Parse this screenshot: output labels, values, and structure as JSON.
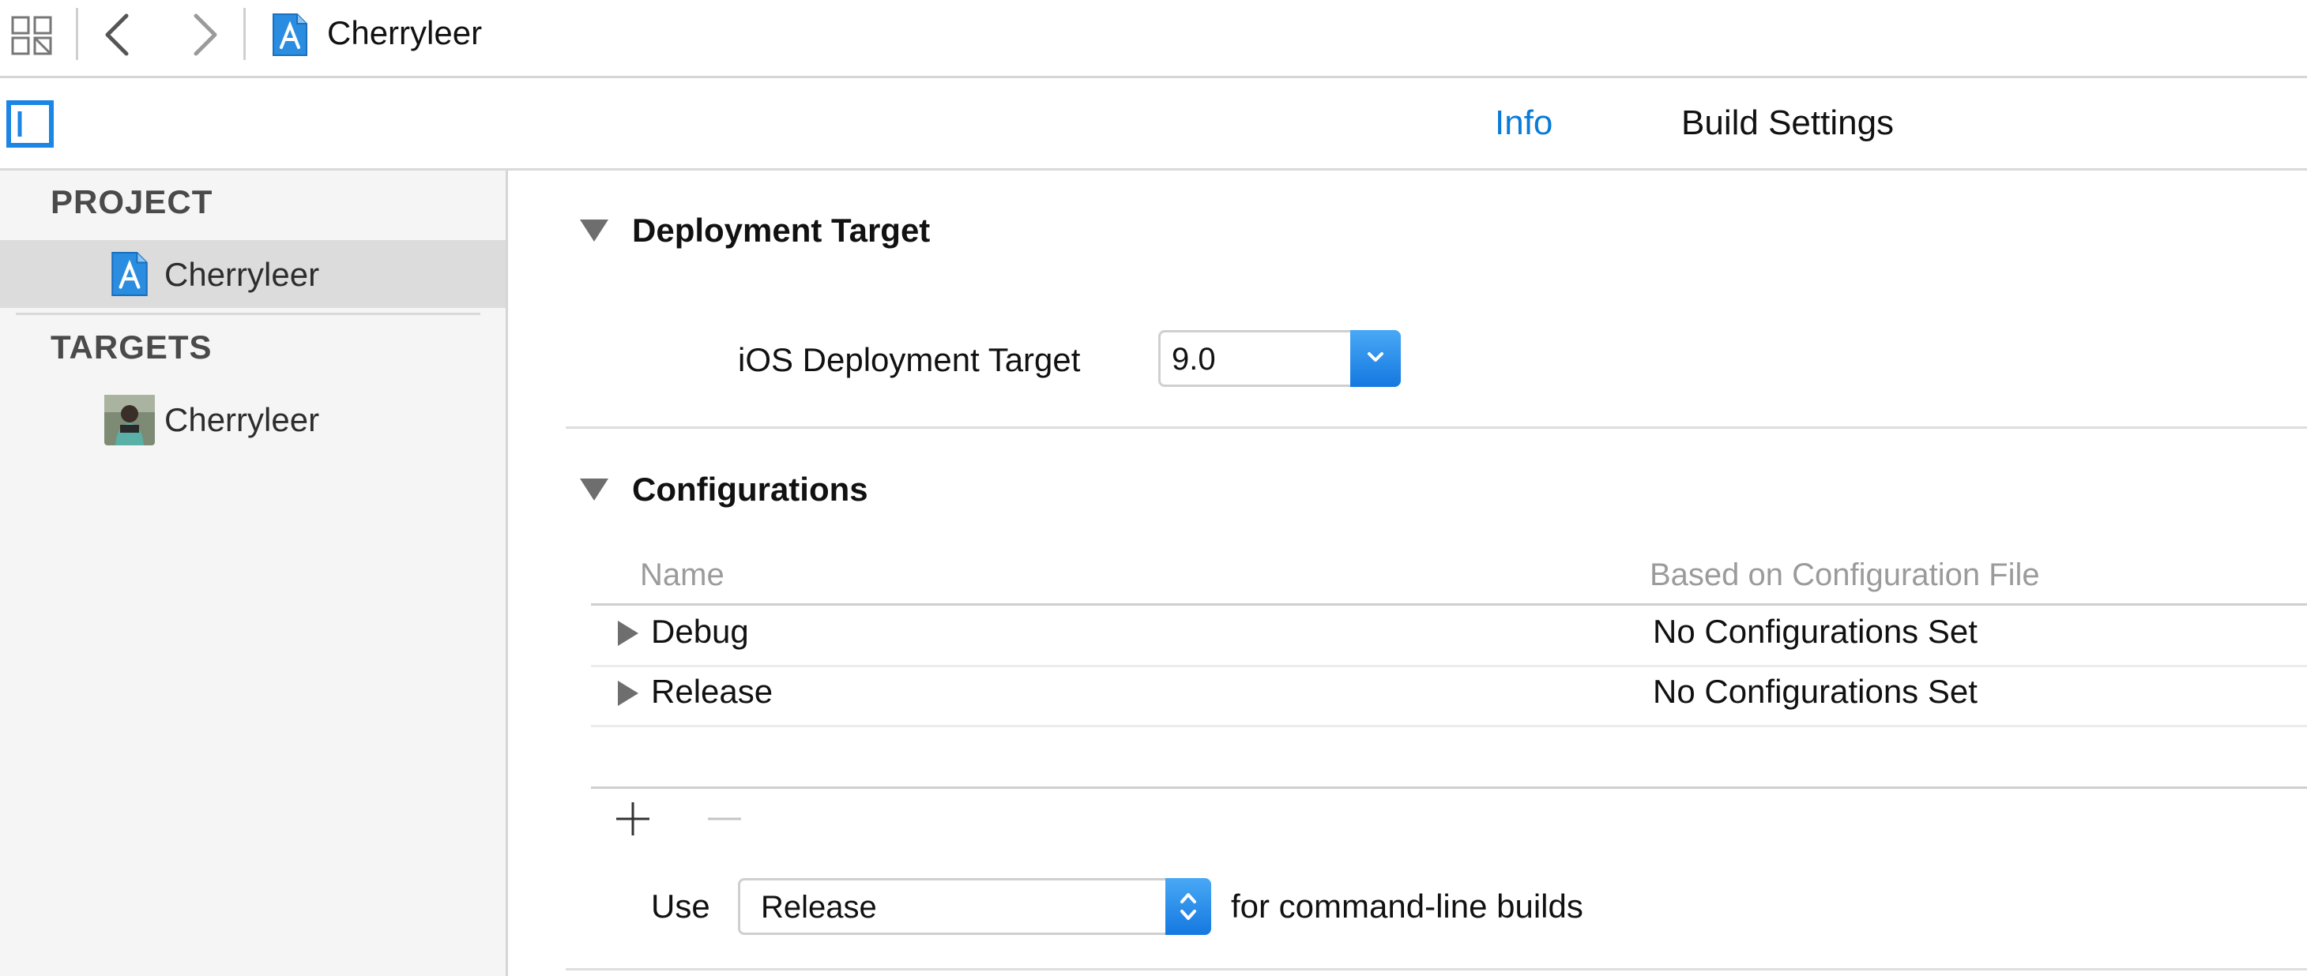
{
  "toolbar": {
    "project_title": "Cherryleer",
    "icons": [
      "related-items-grid-icon",
      "back-chevron-icon",
      "forward-chevron-icon",
      "xcode-project-icon"
    ]
  },
  "tabs": [
    {
      "label": "Info",
      "selected": true
    },
    {
      "label": "Build Settings",
      "selected": false
    }
  ],
  "sidebar": {
    "project_header": "PROJECT",
    "project_item": "Cherryleer",
    "targets_header": "TARGETS",
    "target_item": "Cherryleer"
  },
  "deployment": {
    "title": "Deployment Target",
    "ios_label": "iOS Deployment Target",
    "ios_value": "9.0"
  },
  "configurations": {
    "title": "Configurations",
    "columns": [
      "Name",
      "Based on Configuration File"
    ],
    "rows": [
      {
        "name": "Debug",
        "based_on": "No Configurations Set"
      },
      {
        "name": "Release",
        "based_on": "No Configurations Set"
      }
    ],
    "use_label": "Use",
    "use_value": "Release",
    "use_suffix": "for command-line builds"
  },
  "colors": {
    "accent": "#0a7bd8",
    "selection": "#dcdcdc",
    "popup_button": "#1478e0"
  }
}
